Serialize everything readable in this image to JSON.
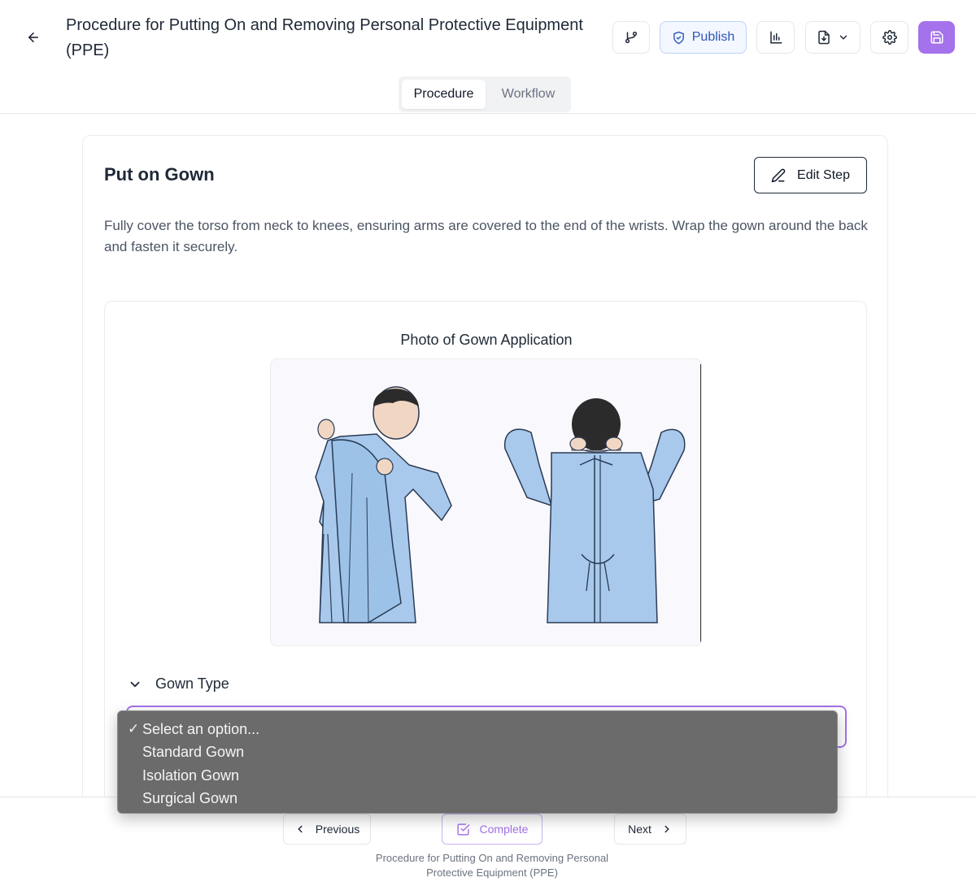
{
  "header": {
    "title": "Procedure for Putting On and Removing Personal Protective Equipment (PPE)",
    "back_icon": "arrow-left-icon",
    "publish_label": "Publish",
    "accent_color": "#a472ea"
  },
  "tabs": [
    {
      "label": "Procedure",
      "active": true
    },
    {
      "label": "Workflow",
      "active": false
    }
  ],
  "step": {
    "title": "Put on Gown",
    "edit_label": "Edit Step",
    "description": "Fully cover the torso from neck to knees, ensuring arms are covered to the end of the wrists. Wrap the gown around the back and fasten it securely.",
    "photo_label": "Photo of Gown Application"
  },
  "gown_type": {
    "title": "Gown Type",
    "options": [
      {
        "label": "Select an option...",
        "selected": true
      },
      {
        "label": "Standard Gown",
        "selected": false
      },
      {
        "label": "Isolation Gown",
        "selected": false
      },
      {
        "label": "Surgical Gown",
        "selected": false
      }
    ],
    "check_mark": "✓"
  },
  "footer": {
    "previous_label": "Previous",
    "complete_label": "Complete",
    "next_label": "Next",
    "procedure_title": "Procedure for Putting On and Removing Personal Protective Equipment (PPE)"
  }
}
